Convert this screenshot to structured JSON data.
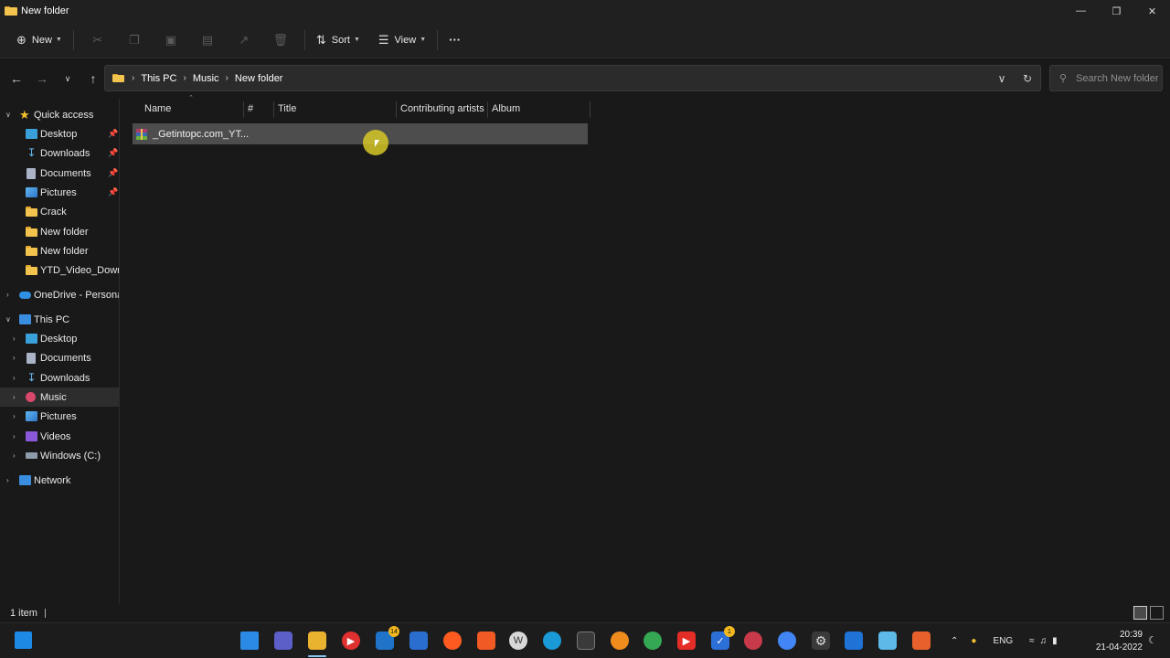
{
  "window": {
    "title": "New folder"
  },
  "toolbar": {
    "new_label": "New",
    "sort_label": "Sort",
    "view_label": "View",
    "more_label": "···"
  },
  "address": {
    "crumbs": [
      "This PC",
      "Music",
      "New folder"
    ]
  },
  "search": {
    "placeholder": "Search New folder"
  },
  "sidebar": {
    "quick_access": "Quick access",
    "quick_items": [
      "Desktop",
      "Downloads",
      "Documents",
      "Pictures",
      "Crack",
      "New folder",
      "New folder",
      "YTD_Video_Downlo"
    ],
    "onedrive": "OneDrive - Personal",
    "this_pc": "This PC",
    "pc_items": [
      "Desktop",
      "Documents",
      "Downloads",
      "Music",
      "Pictures",
      "Videos",
      "Windows (C:)"
    ],
    "network": "Network"
  },
  "columns": [
    "Name",
    "#",
    "Title",
    "Contributing artists",
    "Album"
  ],
  "files": [
    {
      "name": "_Getintopc.com_YT..."
    }
  ],
  "status": {
    "count": "1 item"
  },
  "taskbar": {
    "mail_badge": "14",
    "todo_badge": "1",
    "language": "ENG",
    "time": "20:39",
    "date": "21-04-2022"
  }
}
